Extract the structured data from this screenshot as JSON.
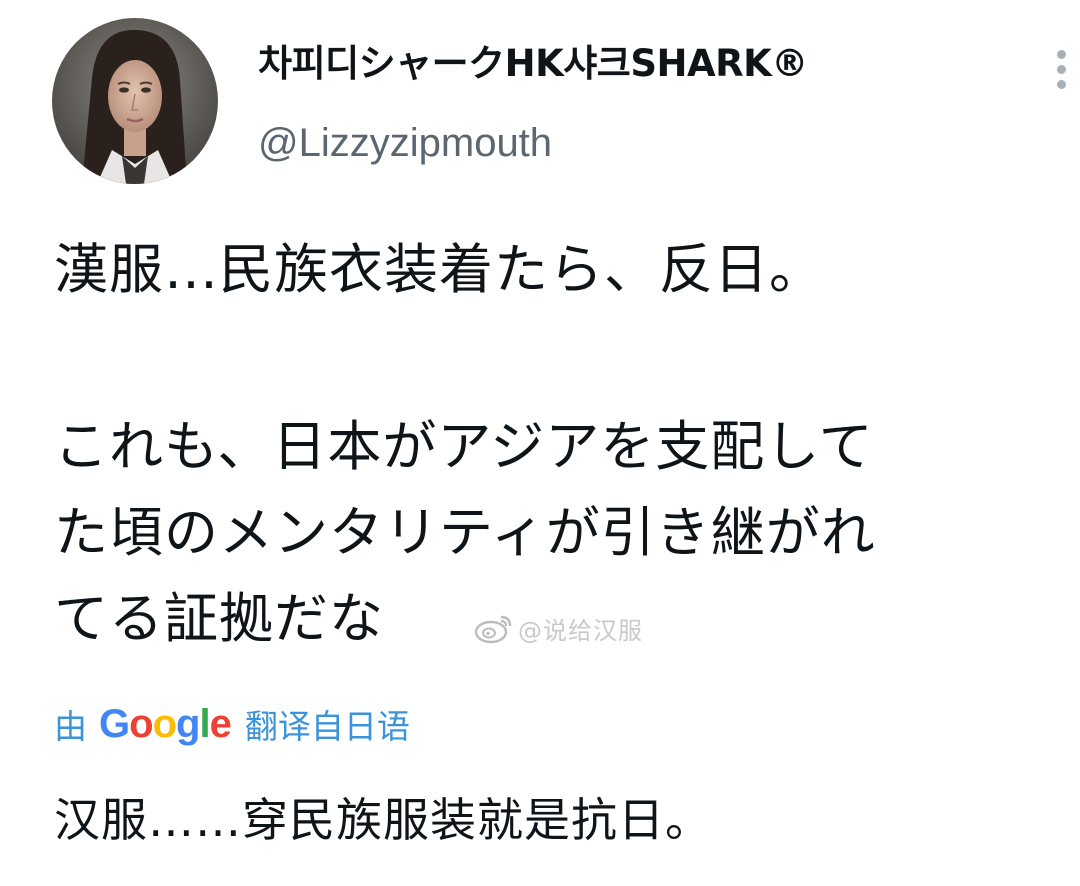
{
  "tweet": {
    "author": {
      "display_name": "차피디シャークHK샤크SHARK®",
      "handle": "@Lizzyzipmouth",
      "avatar_icon": "profile-photo"
    },
    "menu_icon": "more-vertical-icon",
    "text_lines": [
      "漢服…民族衣装着たら、反日。",
      "これも、日本がアジアを支配して",
      "た頃のメンタリティが引き継がれ",
      "てる証拠だな"
    ],
    "watermark": {
      "icon": "weibo-icon",
      "text": "@说给汉服"
    },
    "translation": {
      "by": "由",
      "provider": "Google",
      "from": "翻译自日语",
      "text": "汉服……穿民族服装就是抗日。"
    },
    "colors": {
      "text": "#0f1419",
      "secondary": "#5b6670",
      "link": "#3b94d9",
      "google_blue": "#4285f4",
      "google_red": "#ea4335",
      "google_yellow": "#fbbc05",
      "google_green": "#34a853"
    }
  }
}
